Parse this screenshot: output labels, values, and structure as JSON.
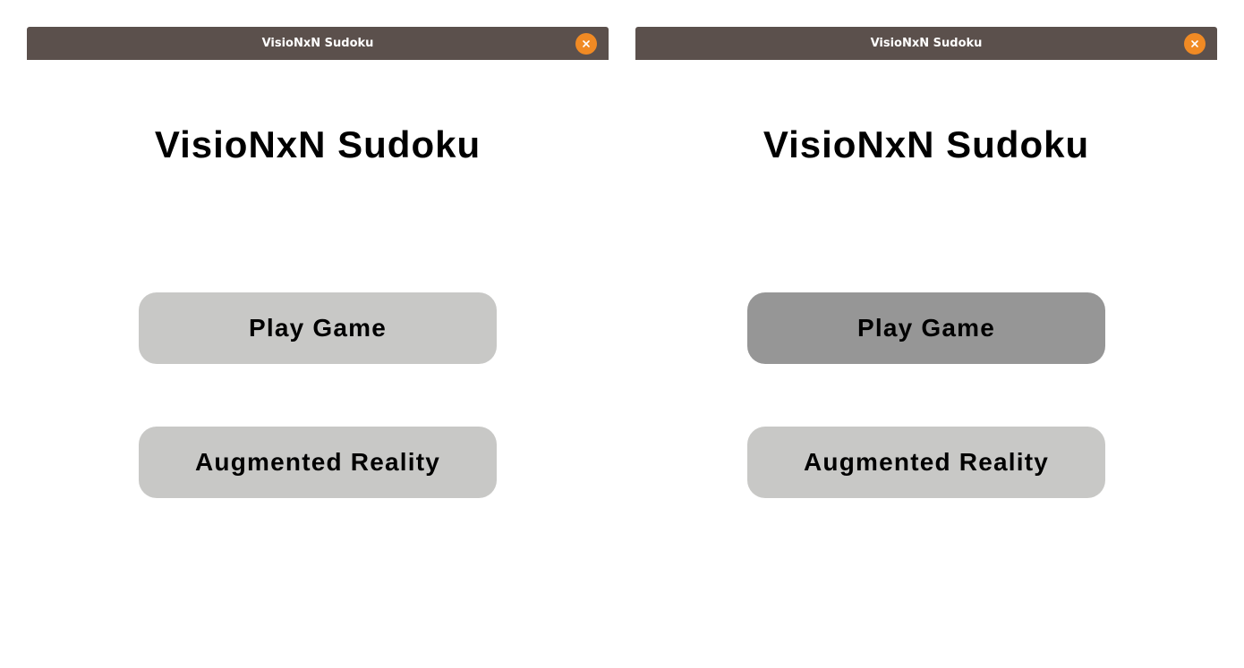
{
  "windows": [
    {
      "window_title": "VisioNxN Sudoku",
      "app_title": "VisioNxN Sudoku",
      "play_label": "Play Game",
      "ar_label": "Augmented Reality",
      "play_state": "normal"
    },
    {
      "window_title": "VisioNxN Sudoku",
      "app_title": "VisioNxN Sudoku",
      "play_label": "Play Game",
      "ar_label": "Augmented Reality",
      "play_state": "hover"
    }
  ],
  "colors": {
    "titlebar": "#5b504c",
    "close_button": "#f08a24",
    "button_normal": "#c8c8c6",
    "button_hover": "#969696"
  },
  "icons": {
    "close": "close-icon"
  }
}
